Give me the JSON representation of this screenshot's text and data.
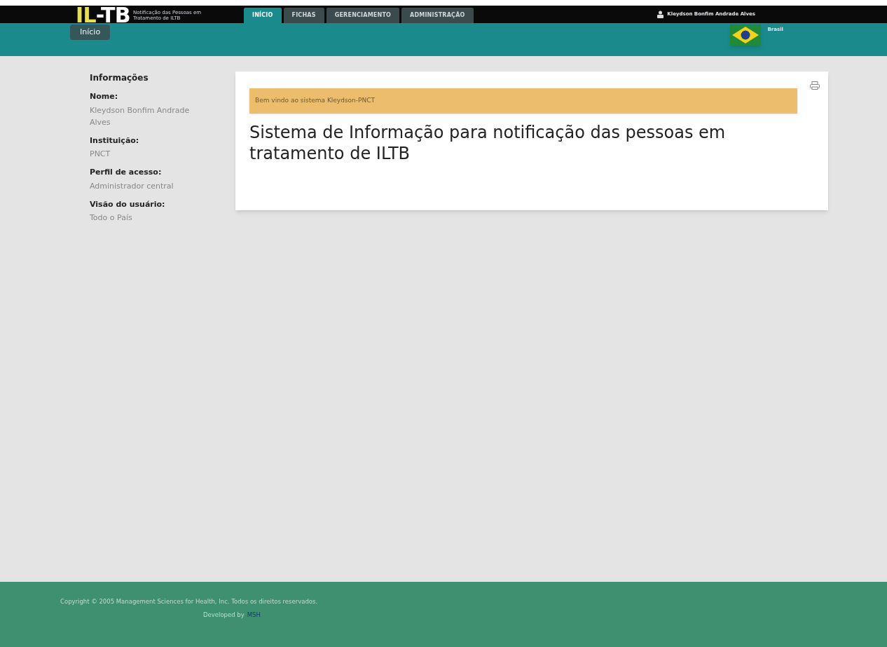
{
  "logo": {
    "mark_left": "IL",
    "mark_right": "-TB",
    "subtitle": "Notificação das Pessoas em Tratamento de ILTB"
  },
  "tabs": [
    {
      "label": "INÍCIO",
      "selected": true
    },
    {
      "label": "FICHAS",
      "selected": false
    },
    {
      "label": "GERENCIAMENTO",
      "selected": false
    },
    {
      "label": "ADMINISTRAÇÃO",
      "selected": false
    }
  ],
  "user": {
    "name": "Kleydson Bonfim Andrade Alves"
  },
  "breadcrumb": "Início",
  "country": "Brasil",
  "sidebar": {
    "title": "Informações",
    "fields": [
      {
        "label": "Nome:",
        "value": "Kleydson Bonfim Andrade Alves"
      },
      {
        "label": "Instituição:",
        "value": "PNCT"
      },
      {
        "label": "Perfil de acesso:",
        "value": "Administrador central"
      },
      {
        "label": "Visão do usuário:",
        "value": "Todo o País"
      }
    ]
  },
  "alert": "Bem vindo ao sistema Kleydson-PNCT",
  "heading": "Sistema de Informação para notificação das pessoas em tratamento de ILTB",
  "footer": {
    "copyright": "Copyright © 2005 Management Sciences for Health, Inc. Todos os direitos reservados.",
    "developed_by": "Developed by",
    "link": "MSH"
  }
}
